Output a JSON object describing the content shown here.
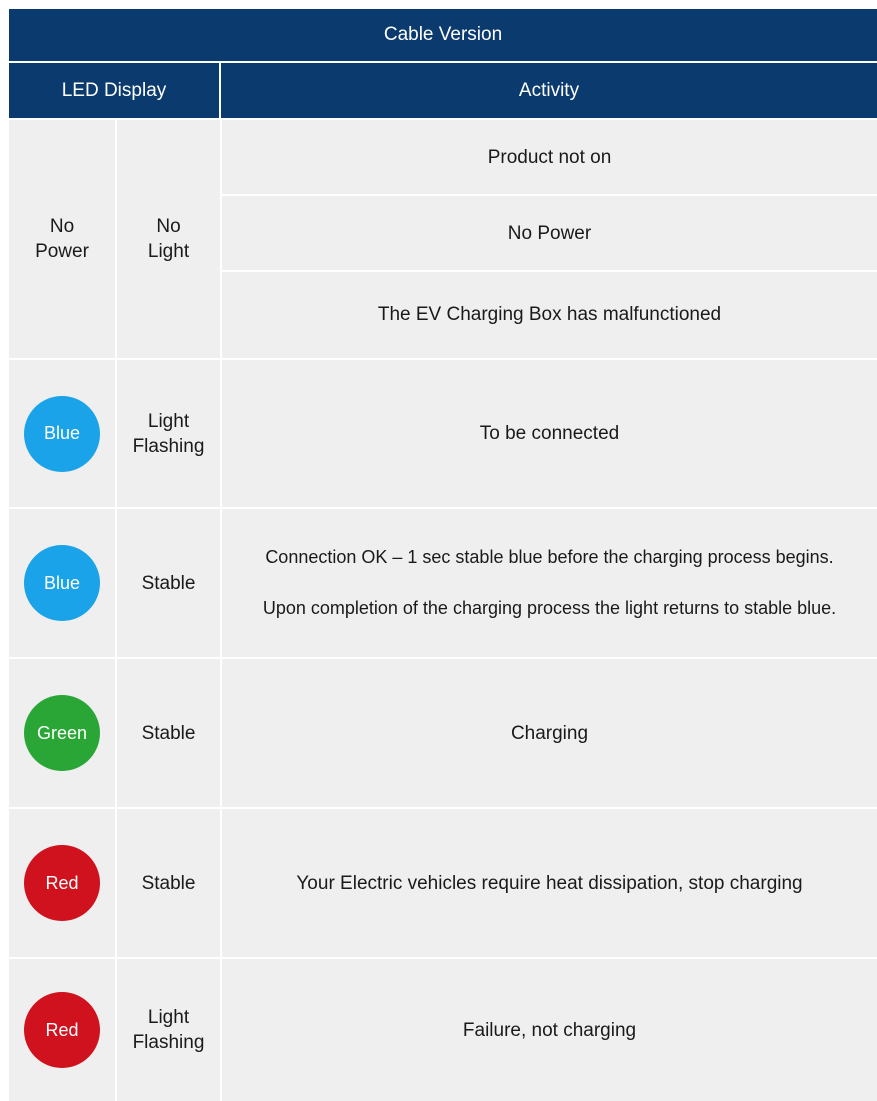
{
  "header": {
    "title": "Cable Version",
    "led_display": "LED Display",
    "activity": "Activity"
  },
  "colors": {
    "header_bg": "#0b3a6e",
    "blue": "#1aa3e8",
    "green": "#2aa637",
    "red": "#d0121e",
    "row_bg": "#efefef"
  },
  "rows": [
    {
      "led": "No Power",
      "mode": "No Light",
      "activities": [
        "Product not on",
        "No Power",
        "The EV Charging Box has malfunctioned"
      ]
    },
    {
      "led": "Blue",
      "mode": "Light Flashing",
      "activities": [
        "To be connected"
      ]
    },
    {
      "led": "Blue",
      "mode": "Stable",
      "activities": [
        "Connection OK – 1 sec stable blue before the charging process begins.",
        "Upon completion of the charging process the light returns to stable blue."
      ]
    },
    {
      "led": "Green",
      "mode": "Stable",
      "activities": [
        "Charging"
      ]
    },
    {
      "led": "Red",
      "mode": "Stable",
      "activities": [
        "Your Electric vehicles require heat dissipation, stop charging"
      ]
    },
    {
      "led": "Red",
      "mode": "Light Flashing",
      "activities": [
        "Failure, not charging"
      ]
    }
  ]
}
